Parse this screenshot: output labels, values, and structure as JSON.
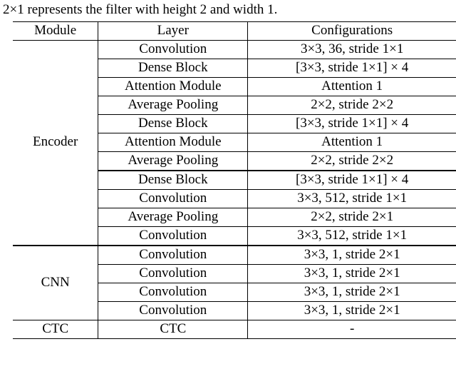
{
  "caption_fragment": "2×1 represents the filter with height 2 and width 1.",
  "header": {
    "c0": "Module",
    "c1": "Layer",
    "c2": "Configurations"
  },
  "modules": {
    "encoder": "Encoder",
    "cnn": "CNN",
    "ctc": "CTC"
  },
  "encoder_rows": [
    {
      "layer": "Convolution",
      "cfg": "3×3, 36, stride 1×1"
    },
    {
      "layer": "Dense Block",
      "cfg": "[3×3, stride 1×1] × 4"
    },
    {
      "layer": "Attention Module",
      "cfg": "Attention 1"
    },
    {
      "layer": "Average Pooling",
      "cfg": "2×2, stride 2×2"
    },
    {
      "layer": "Dense Block",
      "cfg": "[3×3, stride 1×1] × 4"
    },
    {
      "layer": "Attention Module",
      "cfg": "Attention 1"
    },
    {
      "layer": "Average Pooling",
      "cfg": "2×2, stride 2×2"
    },
    {
      "layer": "Dense Block",
      "cfg": "[3×3, stride 1×1] × 4"
    },
    {
      "layer": "Convolution",
      "cfg": "3×3, 512, stride 1×1"
    },
    {
      "layer": "Average Pooling",
      "cfg": "2×2, stride 2×1"
    },
    {
      "layer": "Convolution",
      "cfg": "3×3, 512, stride 1×1"
    }
  ],
  "cnn_rows": [
    {
      "layer": "Convolution",
      "cfg": "3×3, 1, stride 2×1"
    },
    {
      "layer": "Convolution",
      "cfg": "3×3, 1, stride 2×1"
    },
    {
      "layer": "Convolution",
      "cfg": "3×3, 1, stride 2×1"
    },
    {
      "layer": "Convolution",
      "cfg": "3×3, 1, stride 2×1"
    }
  ],
  "ctc_row": {
    "layer": "CTC",
    "cfg": "-"
  }
}
